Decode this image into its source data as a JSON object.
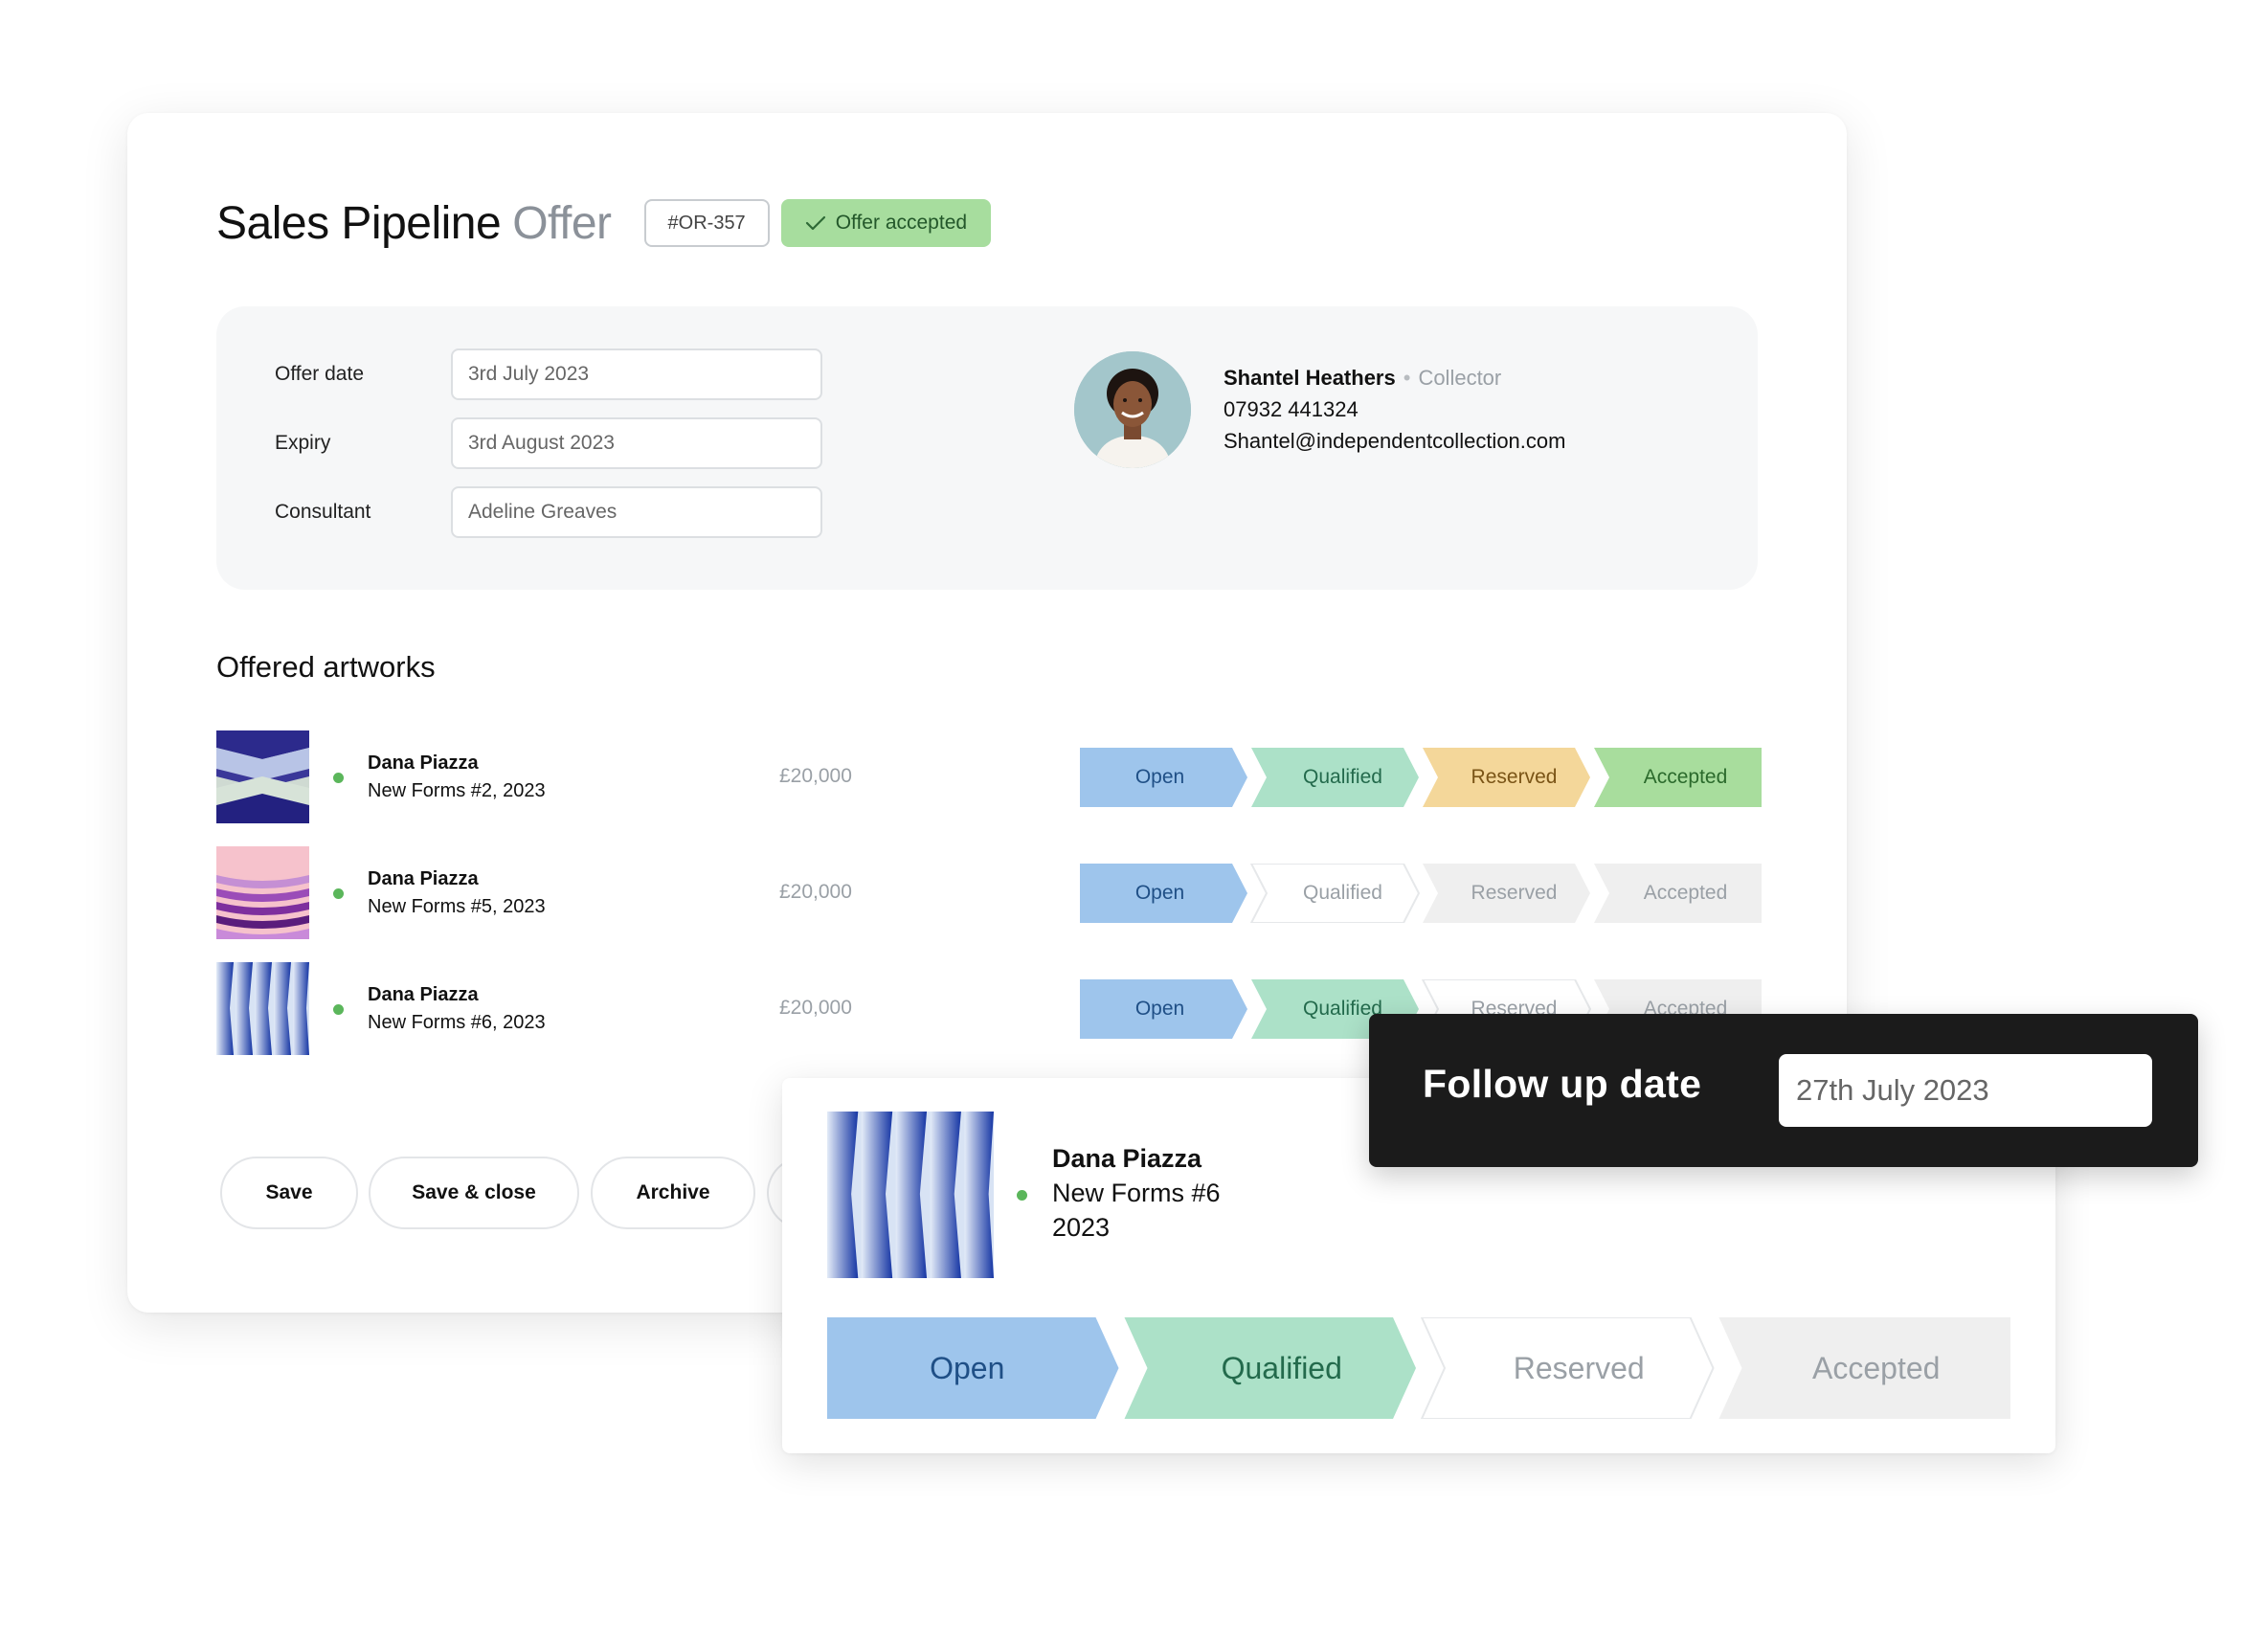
{
  "header": {
    "title": "Sales Pipeline",
    "subtitle": "Offer",
    "reference": "#OR-357",
    "status": "Offer accepted"
  },
  "details": {
    "fields": [
      {
        "label": "Offer date",
        "value": "3rd July 2023"
      },
      {
        "label": "Expiry",
        "value": "3rd August 2023"
      },
      {
        "label": "Consultant",
        "value": "Adeline Greaves"
      }
    ],
    "contact": {
      "name": "Shantel Heathers",
      "role": "Collector",
      "phone": "07932 441324",
      "email": "Shantel@independentcollection.com"
    }
  },
  "artworks": {
    "section_title": "Offered artworks",
    "stages": [
      "Open",
      "Qualified",
      "Reserved",
      "Accepted"
    ],
    "items": [
      {
        "artist": "Dana Piazza",
        "title": "New Forms #2, 2023",
        "price": "£20,000",
        "stage_reached": 4
      },
      {
        "artist": "Dana Piazza",
        "title": "New Forms #5, 2023",
        "price": "£20,000",
        "stage_reached": 1
      },
      {
        "artist": "Dana Piazza",
        "title": "New Forms #6, 2023",
        "price": "£20,000",
        "stage_reached": 2
      }
    ]
  },
  "actions": {
    "save": "Save",
    "save_close": "Save & close",
    "archive": "Archive"
  },
  "detail_card": {
    "artist": "Dana Piazza",
    "title": "New Forms #6",
    "year": "2023",
    "stage_reached": 2
  },
  "follow_up": {
    "label": "Follow up date",
    "value": "27th July 2023"
  },
  "colors": {
    "open": "#9ec5ec",
    "qualified": "#ace1c8",
    "reserved": "#f4d79a",
    "accepted": "#a8dd9d",
    "inactive": "#efefef",
    "status_badge": "#a7dd9e"
  }
}
